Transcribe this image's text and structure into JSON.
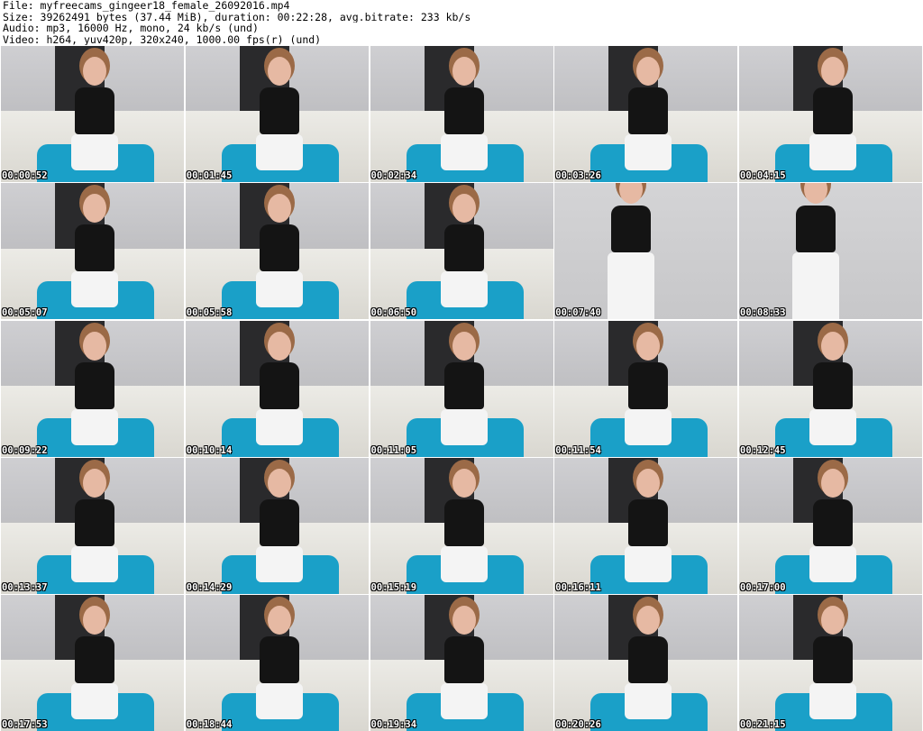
{
  "header": {
    "file": "File: myfreecams_gingeer18_female_26092016.mp4",
    "size": "Size: 39262491 bytes (37.44 MiB), duration: 00:22:28, avg.bitrate: 233 kb/s",
    "audio": "Audio: mp3, 16000 Hz, mono, 24 kb/s (und)",
    "video": "Video: h264, yuv420p, 320x240, 1000.00 fps(r) (und)"
  },
  "thumbnails": [
    {
      "timestamp": "00:00:52"
    },
    {
      "timestamp": "00:01:45"
    },
    {
      "timestamp": "00:02:34"
    },
    {
      "timestamp": "00:03:26"
    },
    {
      "timestamp": "00:04:15"
    },
    {
      "timestamp": "00:05:07"
    },
    {
      "timestamp": "00:05:58"
    },
    {
      "timestamp": "00:06:50"
    },
    {
      "timestamp": "00:07:40"
    },
    {
      "timestamp": "00:08:33"
    },
    {
      "timestamp": "00:09:22"
    },
    {
      "timestamp": "00:10:14"
    },
    {
      "timestamp": "00:11:05"
    },
    {
      "timestamp": "00:11:54"
    },
    {
      "timestamp": "00:12:45"
    },
    {
      "timestamp": "00:13:37"
    },
    {
      "timestamp": "00:14:29"
    },
    {
      "timestamp": "00:15:19"
    },
    {
      "timestamp": "00:16:11"
    },
    {
      "timestamp": "00:17:00"
    },
    {
      "timestamp": "00:17:53"
    },
    {
      "timestamp": "00:18:44"
    },
    {
      "timestamp": "00:19:34"
    },
    {
      "timestamp": "00:20:26"
    },
    {
      "timestamp": "00:21:15"
    }
  ]
}
